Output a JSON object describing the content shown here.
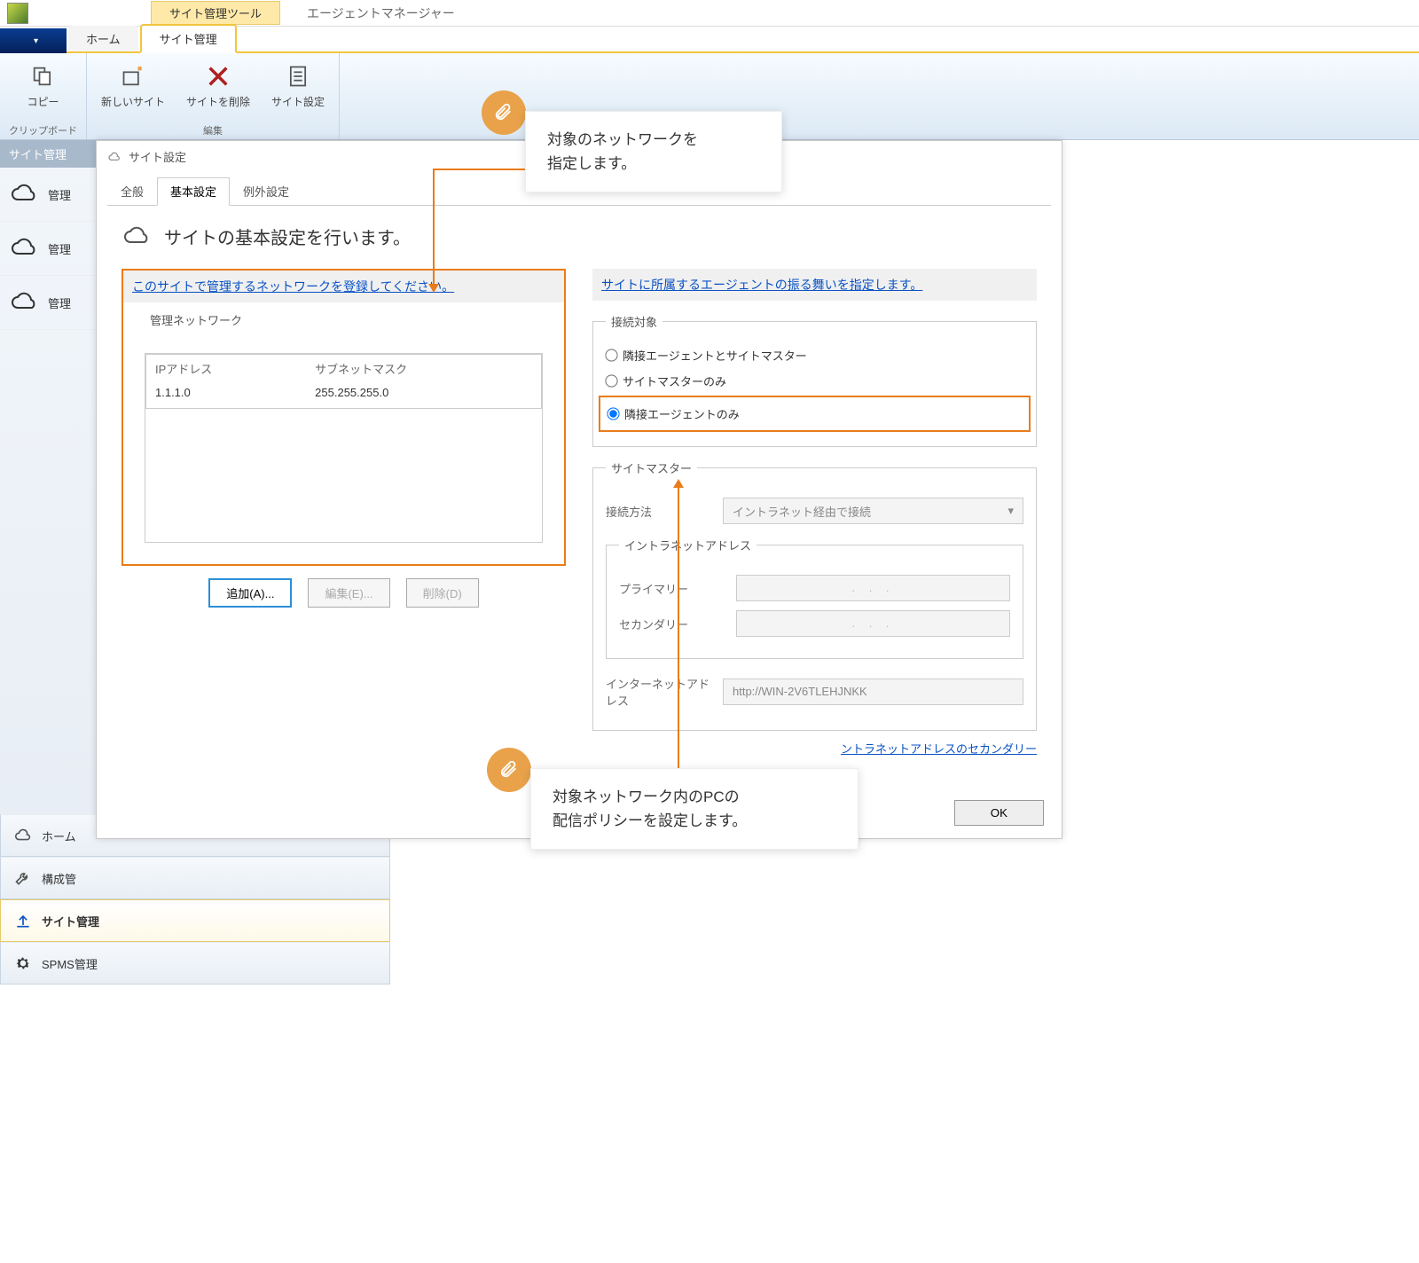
{
  "titlebar": {
    "tool_label": "サイト管理ツール",
    "app_title": "エージェントマネージャー"
  },
  "tabs": {
    "home": "ホーム",
    "site_mgmt": "サイト管理"
  },
  "ribbon": {
    "copy": "コピー",
    "clipboard": "クリップボード",
    "new_site": "新しいサイト",
    "delete_site": "サイトを削除",
    "site_settings": "サイト設定",
    "edit": "編集"
  },
  "leftbar": {
    "header": "サイト管理",
    "items": [
      "管理",
      "管理",
      "管理"
    ]
  },
  "bottomnav": {
    "home": "ホーム",
    "config": "構成管",
    "site": "サイト管理",
    "spms": "SPMS管理"
  },
  "dialog": {
    "title": "サイト設定",
    "tabs": {
      "general": "全般",
      "basic": "基本設定",
      "exception": "例外設定"
    },
    "heading": "サイトの基本設定を行います。",
    "left_link": "このサイトで管理するネットワークを登録してください。",
    "right_link": "サイトに所属するエージェントの振る舞いを指定します。",
    "network_legend": "管理ネットワーク",
    "table": {
      "ip_header": "IPアドレス",
      "mask_header": "サブネットマスク",
      "ip_value": "1.1.1.0",
      "mask_value": "255.255.255.0"
    },
    "buttons": {
      "add": "追加(A)...",
      "edit": "編集(E)...",
      "delete": "削除(D)"
    },
    "connection_legend": "接続対象",
    "radios": {
      "both": "隣接エージェントとサイトマスター",
      "master_only": "サイトマスターのみ",
      "agent_only": "隣接エージェントのみ"
    },
    "sitemaster_legend": "サイトマスター",
    "connection_method_label": "接続方法",
    "connection_method_value": "イントラネット経由で接続",
    "intranet_legend": "イントラネットアドレス",
    "primary_label": "プライマリー",
    "secondary_label": "セカンダリー",
    "ip_placeholder": ".    .    .",
    "internet_label": "インターネットアドレス",
    "internet_value": "http://WIN-2V6TLEHJNKK",
    "secondary_link": "ントラネットアドレスのセカンダリー",
    "ok": "OK"
  },
  "callouts": {
    "top": "対象のネットワークを\n指定します。",
    "bottom": "対象ネットワーク内のPCの\n配信ポリシーを設定します。"
  }
}
